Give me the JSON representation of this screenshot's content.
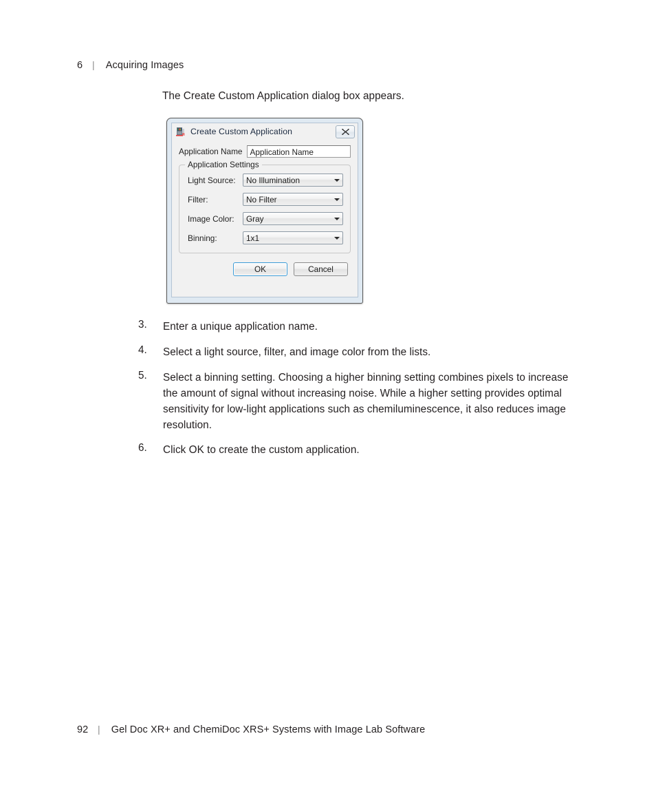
{
  "header": {
    "chapter_number": "6",
    "separator": "|",
    "chapter_title": "Acquiring Images"
  },
  "intro": {
    "text": "The Create Custom Application dialog box appears."
  },
  "dialog": {
    "title": "Create Custom Application",
    "app_icon": "application-icon",
    "close_icon": "close-icon",
    "application_name": {
      "label": "Application Name",
      "value": "Application Name"
    },
    "group": {
      "title": "Application Settings",
      "rows": [
        {
          "label": "Light Source:",
          "value": "No Illumination"
        },
        {
          "label": "Filter:",
          "value": "No Filter"
        },
        {
          "label": "Image Color:",
          "value": "Gray"
        },
        {
          "label": "Binning:",
          "value": "1x1"
        }
      ]
    },
    "buttons": {
      "ok": "OK",
      "cancel": "Cancel"
    },
    "colors": {
      "frame": "#dfe9f2",
      "face": "#f1f1f1",
      "default_button_focus": "#3c9bd6",
      "border": "#5a5a5a"
    }
  },
  "steps": [
    {
      "number": "3.",
      "text": "Enter a unique application name."
    },
    {
      "number": "4.",
      "text": "Select a light source, filter, and image color from the lists."
    },
    {
      "number": "5.",
      "text": "Select a binning setting. Choosing a higher binning setting combines pixels to increase the amount of signal without increasing noise. While a higher setting provides optimal sensitivity for low-light applications such as chemiluminescence, it also reduces image resolution."
    },
    {
      "number": "6.",
      "text": "Click OK to create the custom application."
    }
  ],
  "footer": {
    "page_number": "92",
    "separator": "|",
    "title": "Gel Doc XR+ and ChemiDoc XRS+ Systems with Image Lab Software"
  }
}
